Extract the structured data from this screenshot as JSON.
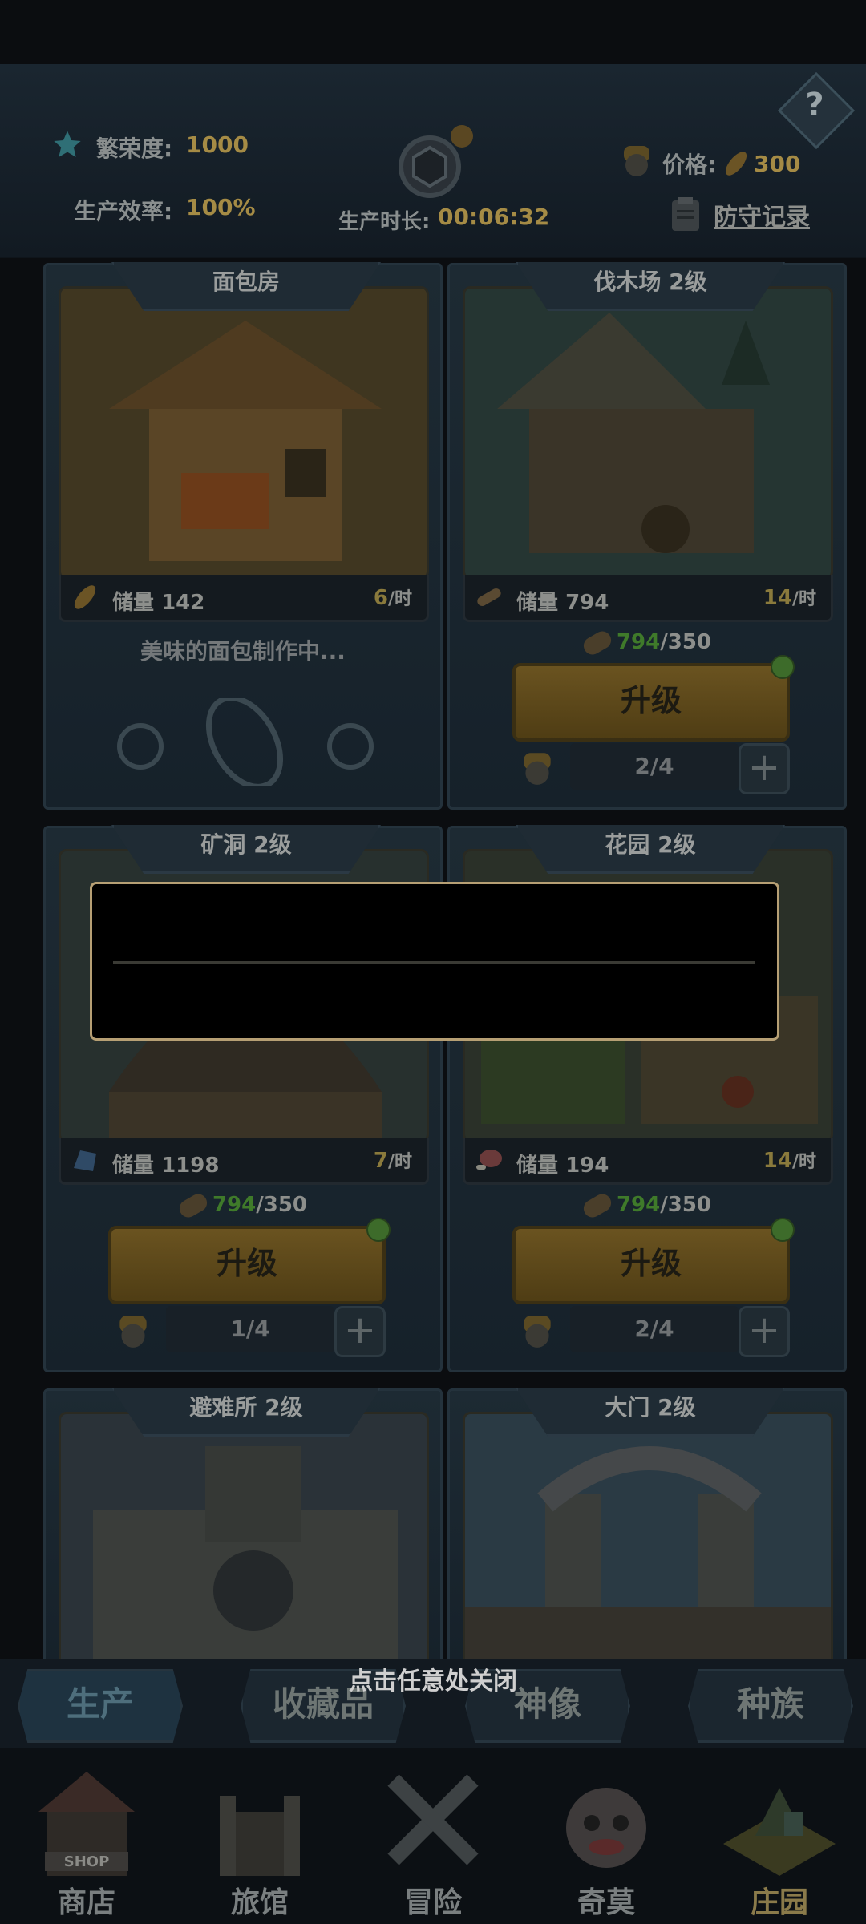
{
  "header": {
    "prosperity_label": "繁荣度:",
    "prosperity_value": "1000",
    "efficiency_label": "生产效率:",
    "efficiency_value": "100%",
    "duration_label": "生产时长:",
    "duration_value": "00:06:32",
    "price_label": "价格:",
    "price_value": "300",
    "defense_record": "防守记录",
    "help": "?"
  },
  "buildings": [
    {
      "title": "面包房",
      "stock_label": "储量",
      "stock_value": "142",
      "rate_value": "6",
      "rate_unit": "/时",
      "status_text": "美味的面包制作中..."
    },
    {
      "title": "伐木场  2级",
      "stock_label": "储量",
      "stock_value": "794",
      "rate_value": "14",
      "rate_unit": "/时",
      "cost_have": "794",
      "cost_need": "/350",
      "upgrade_label": "升级",
      "workers": "2/4",
      "plus": "+"
    },
    {
      "title": "矿洞  2级",
      "stock_label": "储量",
      "stock_value": "1198",
      "rate_value": "7",
      "rate_unit": "/时",
      "cost_have": "794",
      "cost_need": "/350",
      "upgrade_label": "升级",
      "workers": "1/4",
      "plus": "+"
    },
    {
      "title": "花园  2级",
      "stock_label": "储量",
      "stock_value": "194",
      "rate_value": "14",
      "rate_unit": "/时",
      "cost_have": "794",
      "cost_need": "/350",
      "upgrade_label": "升级",
      "workers": "2/4",
      "plus": "+"
    },
    {
      "title": "避难所  2级"
    },
    {
      "title": "大门  2级"
    }
  ],
  "close_hint": "点击任意处关闭",
  "tabs": [
    {
      "label": "生产"
    },
    {
      "label": "收藏品"
    },
    {
      "label": "神像"
    },
    {
      "label": "种族"
    }
  ],
  "nav": [
    {
      "label": "商店",
      "icon": "shop-icon",
      "sign": "SHOP"
    },
    {
      "label": "旅馆",
      "icon": "inn-icon"
    },
    {
      "label": "冒险",
      "icon": "crossed-swords-icon"
    },
    {
      "label": "奇莫",
      "icon": "chimo-creature-icon"
    },
    {
      "label": "庄园",
      "icon": "manor-island-icon"
    }
  ],
  "colors": {
    "accent_gold": "#a58b45",
    "popup_border": "#b69f74",
    "have_green": "#3f7a2a"
  }
}
